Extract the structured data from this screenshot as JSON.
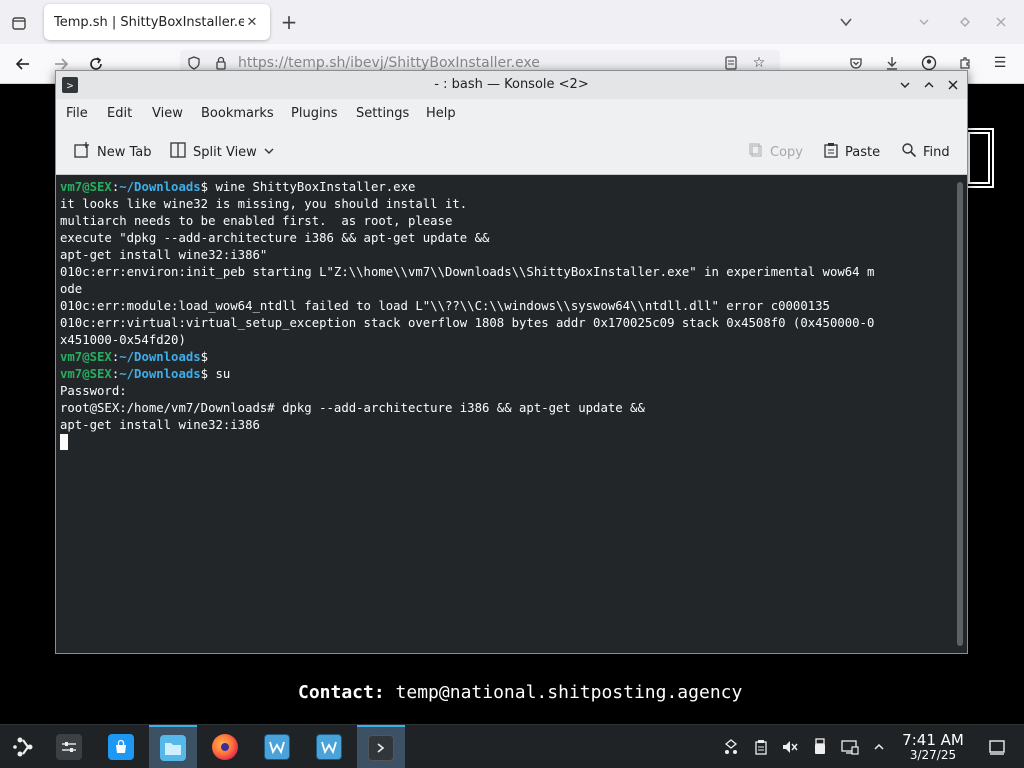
{
  "browser": {
    "tab_title": "Temp.sh | ShittyBoxInstaller.e",
    "url": "https://temp.sh/ibevj/ShittyBoxInstaller.exe"
  },
  "page": {
    "contact_label": "Contact:",
    "contact_email": "temp@national.shitposting.agency"
  },
  "konsole": {
    "title": "- : bash — Konsole <2>",
    "menu": [
      "File",
      "Edit",
      "View",
      "Bookmarks",
      "Plugins",
      "Settings",
      "Help"
    ],
    "toolbar": {
      "new_tab": "New Tab",
      "split_view": "Split View",
      "copy": "Copy",
      "paste": "Paste",
      "find": "Find"
    },
    "terminal": {
      "prompt_user": "vm7@SEX",
      "prompt_path": "~/Downloads",
      "cmd1": " wine ShittyBoxInstaller.exe",
      "out": [
        "it looks like wine32 is missing, you should install it.",
        "multiarch needs to be enabled first.  as root, please",
        "execute \"dpkg --add-architecture i386 && apt-get update &&",
        "apt-get install wine32:i386\"",
        "010c:err:environ:init_peb starting L\"Z:\\\\home\\\\vm7\\\\Downloads\\\\ShittyBoxInstaller.exe\" in experimental wow64 m",
        "ode",
        "010c:err:module:load_wow64_ntdll failed to load L\"\\\\??\\\\C:\\\\windows\\\\syswow64\\\\ntdll.dll\" error c0000135",
        "010c:err:virtual:virtual_setup_exception stack overflow 1808 bytes addr 0x170025c09 stack 0x4508f0 (0x450000-0",
        "x451000-0x54fd20)"
      ],
      "cmd3": " su",
      "password": "Password:",
      "root1": "root@SEX:/home/vm7/Downloads# dpkg --add-architecture i386 && apt-get update &&",
      "root2": "apt-get install wine32:i386"
    }
  },
  "taskbar": {
    "time": "7:41 AM",
    "date": "3/27/25"
  },
  "colors": {
    "terminal_bg": "#232629",
    "prompt_user": "#27ae60",
    "prompt_path": "#3daee9",
    "taskbar_bg": "#1f2326"
  }
}
